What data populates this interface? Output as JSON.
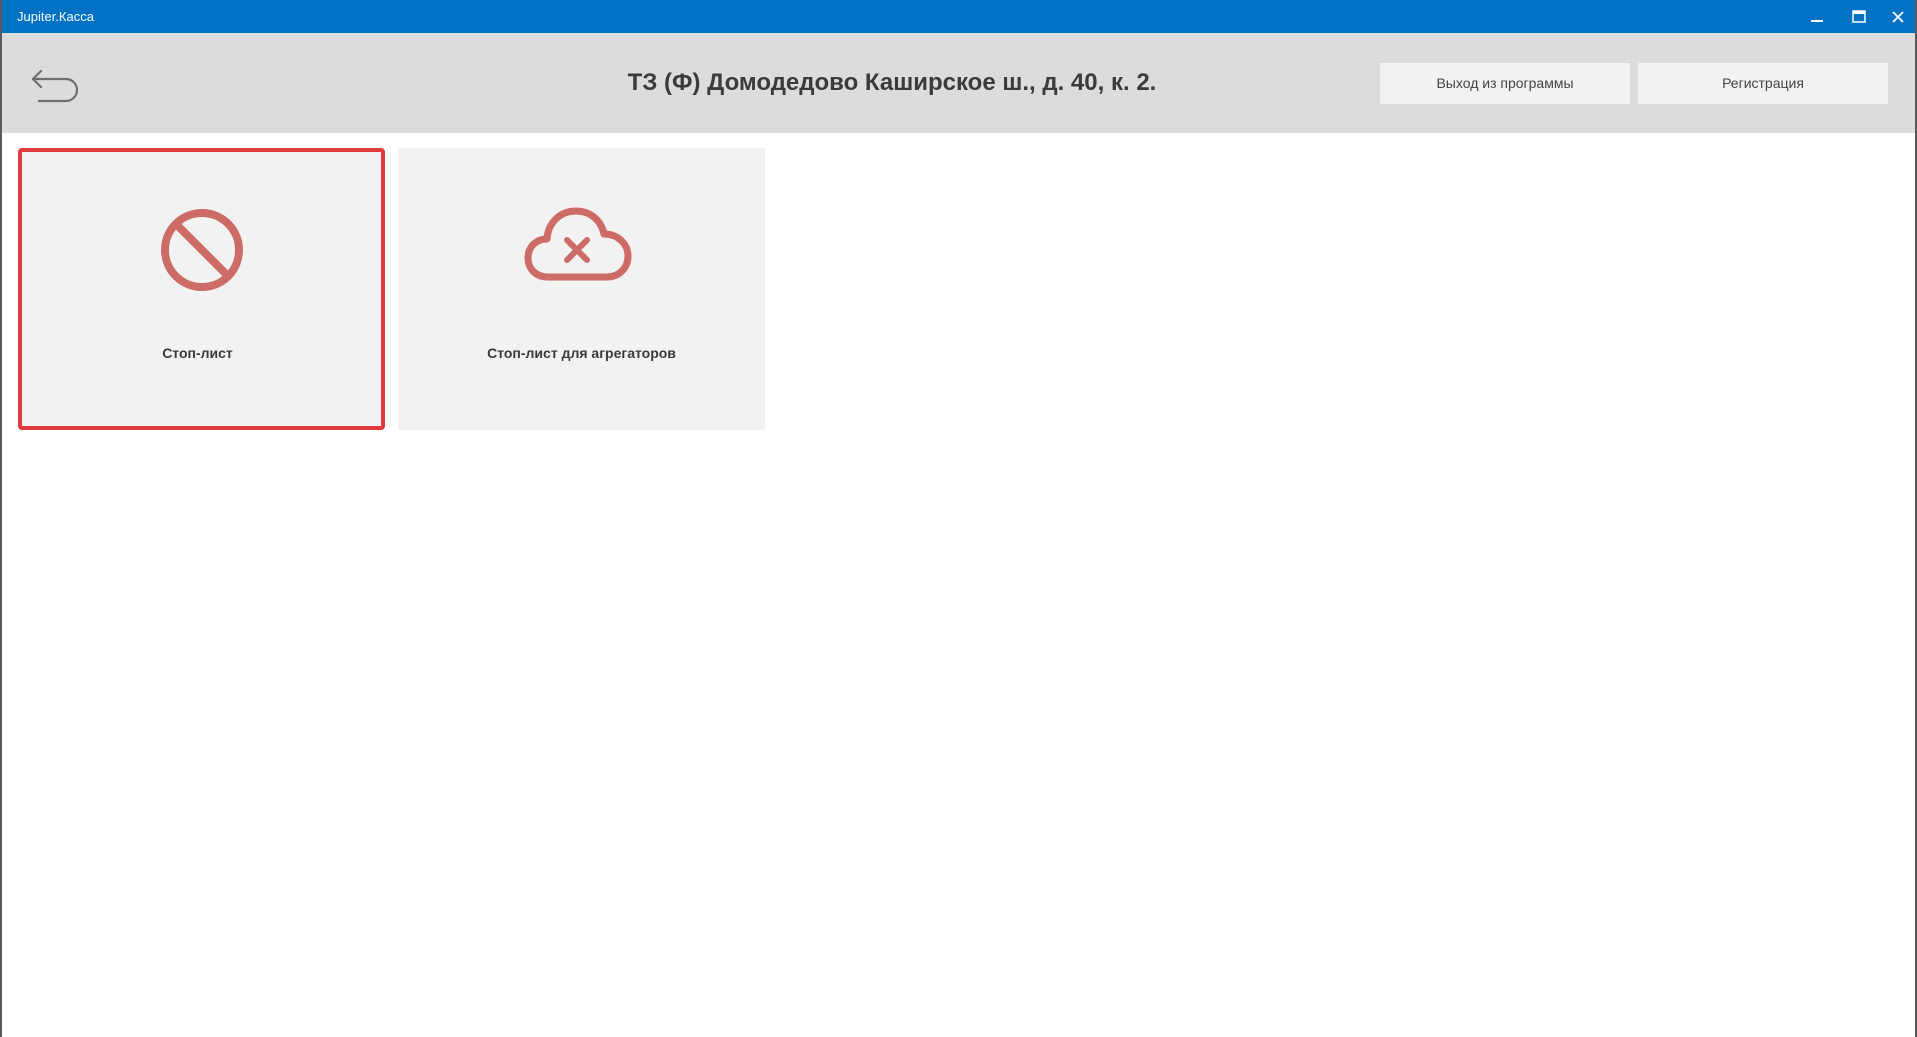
{
  "window": {
    "title": "Jupiter.Касса",
    "titlebar_color": "#0072c6",
    "controls": [
      "minimize-icon",
      "maximize-icon",
      "close-icon"
    ]
  },
  "header": {
    "back_icon": "back-arrow-icon",
    "title": "ТЗ (Ф) Домодедово Каширское ш., д. 40, к. 2.",
    "buttons": {
      "exit_label": "Выход из программы",
      "register_label": "Регистрация"
    }
  },
  "tiles": [
    {
      "label": "Стоп-лист",
      "icon": "prohibited-icon",
      "selected": true
    },
    {
      "label": "Стоп-лист для агрегаторов",
      "icon": "cloud-x-icon",
      "selected": false
    }
  ],
  "colors": {
    "accent_red": "#e0393e",
    "icon_red": "#cd6b66",
    "header_bg": "#dcdcdc",
    "tile_bg": "#f2f2f2"
  }
}
